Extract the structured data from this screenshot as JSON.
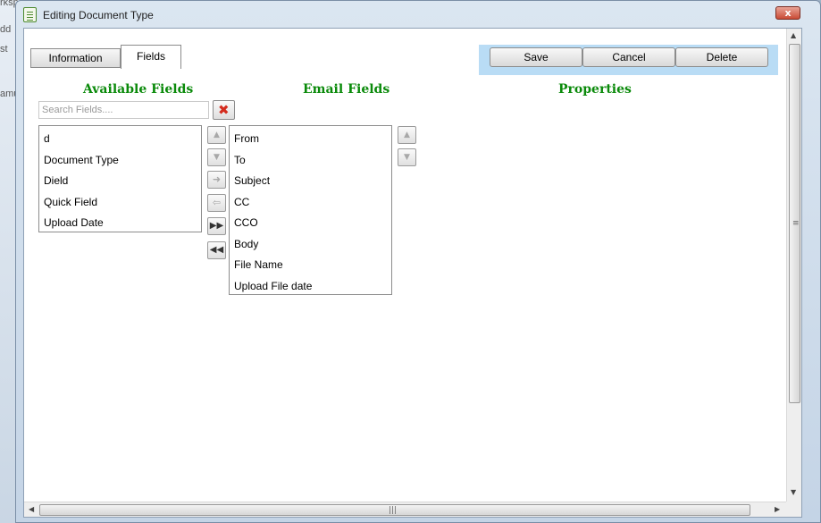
{
  "window": {
    "title": "Editing Document Type",
    "close_label": "x"
  },
  "background": {
    "fragments": [
      "rkspace",
      "dd",
      "st",
      "amur"
    ]
  },
  "tabs": [
    {
      "label": "Information",
      "active": false
    },
    {
      "label": "Fields",
      "active": true
    }
  ],
  "actions": {
    "save": "Save",
    "cancel": "Cancel",
    "delete": "Delete"
  },
  "columns": {
    "available_title": "Available Fields",
    "email_title": "Email Fields",
    "properties_title": "Properties"
  },
  "search": {
    "placeholder": "Search Fields....",
    "value": ""
  },
  "available_fields": [
    "d",
    "Document Type",
    "Dield",
    "Quick Field",
    "Upload Date"
  ],
  "email_fields": [
    "From",
    "To",
    "Subject",
    "CC",
    "CCO",
    "Body",
    "File Name",
    "Upload File date"
  ],
  "icons": {
    "clear": "close-red-x-icon",
    "move_up": "arrow-up-icon",
    "move_down": "arrow-down-icon",
    "add": "arrow-right-icon",
    "remove": "arrow-left-icon",
    "add_all": "double-arrow-right-icon",
    "remove_all": "double-arrow-left-icon"
  },
  "colors": {
    "title_green": "#0a8a0a",
    "action_bar_bg": "#b9dcf5",
    "close_red": "#c94b36"
  }
}
